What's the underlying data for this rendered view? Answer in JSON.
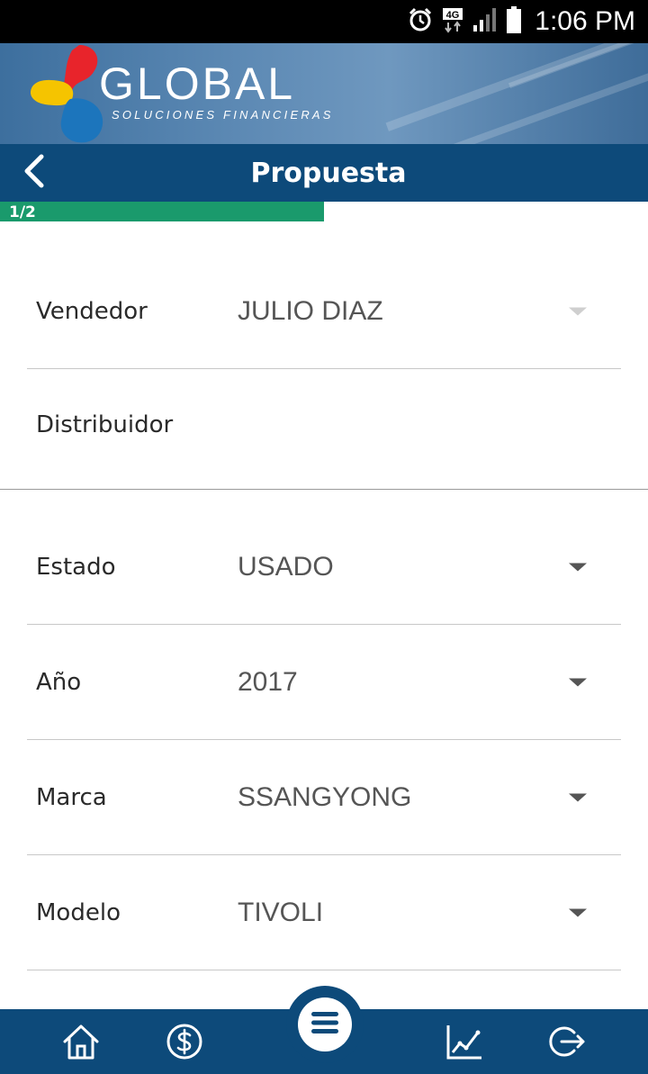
{
  "status_bar": {
    "time": "1:06 PM",
    "network": "4G",
    "icons": [
      "alarm-icon",
      "data-4g-icon",
      "signal-icon",
      "battery-icon"
    ]
  },
  "banner": {
    "brand": "GLOBAL",
    "tagline": "SOLUCIONES FINANCIERAS",
    "brand_colors": [
      "#e8242b",
      "#f5c400",
      "#1c75bc"
    ]
  },
  "header": {
    "title": "Propuesta",
    "back_icon": "chevron-left-icon",
    "bar_color": "#0d4a7a"
  },
  "progress": {
    "label": "1/2",
    "fraction": 0.5,
    "color": "#1a9a6c"
  },
  "form": {
    "vendedor": {
      "label": "Vendedor",
      "value": "JULIO DIAZ"
    },
    "distribuidor": {
      "label": "Distribuidor",
      "value": ""
    },
    "estado": {
      "label": "Estado",
      "value": "USADO"
    },
    "anio": {
      "label": "Año",
      "value": "2017"
    },
    "marca": {
      "label": "Marca",
      "value": "SSANGYONG"
    },
    "modelo": {
      "label": "Modelo",
      "value": "TIVOLI"
    }
  },
  "bottom_nav": {
    "items": [
      "home-icon",
      "dollar-icon",
      "menu-icon",
      "chart-icon",
      "logout-icon"
    ]
  }
}
